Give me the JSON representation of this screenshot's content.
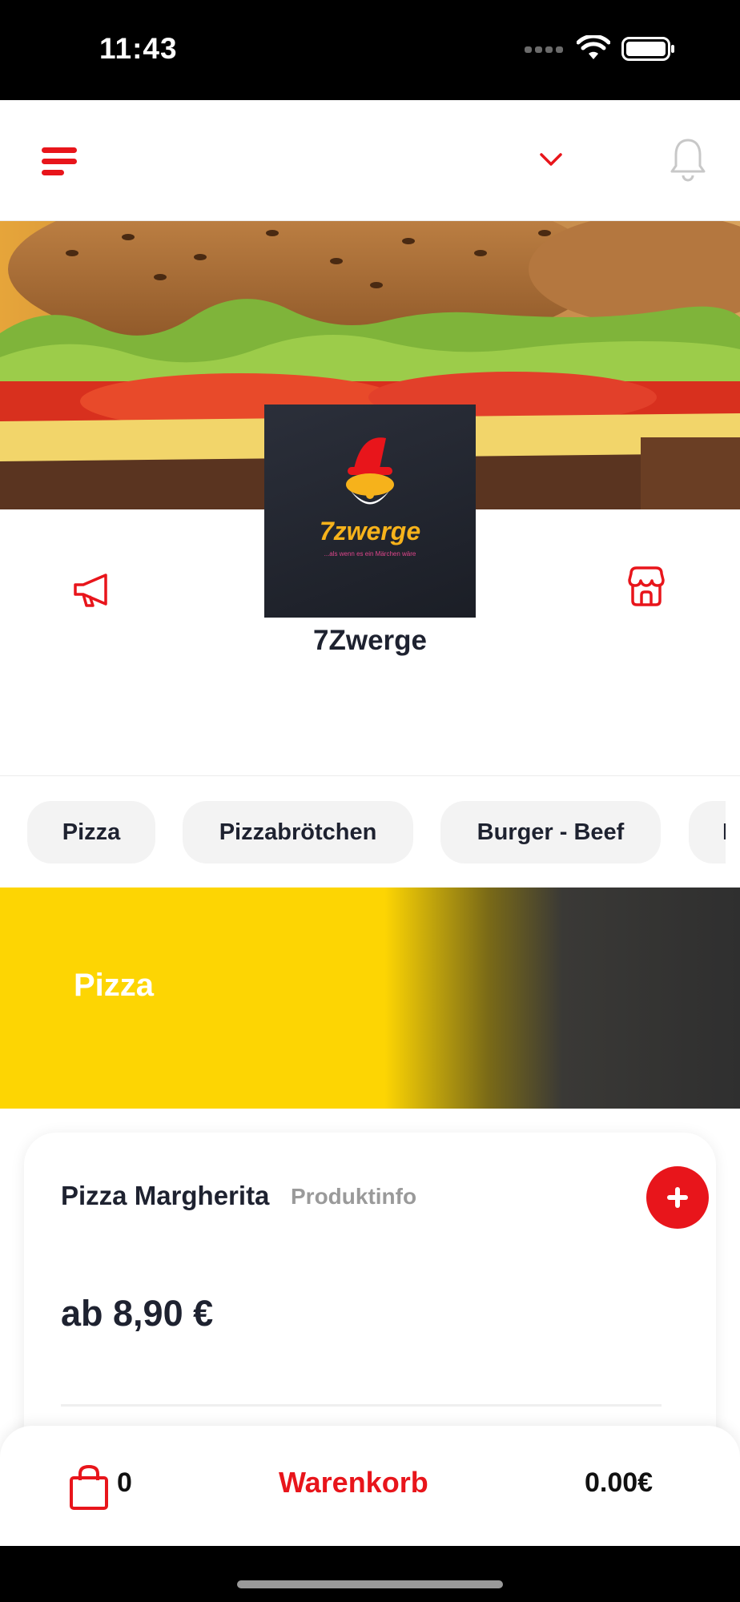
{
  "status_bar": {
    "time": "11:43"
  },
  "header": {
    "menu_icon": "menu-icon",
    "dropdown_icon": "chevron-down-icon",
    "notification_icon": "bell-icon"
  },
  "restaurant": {
    "name": "7Zwerge",
    "logo_text": "7zwerge",
    "logo_tagline": "...als wenn es ein Märchen wäre",
    "left_icon": "megaphone-icon",
    "right_icon": "shop-icon"
  },
  "categories": [
    "Pizza",
    "Pizzabrötchen",
    "Burger - Beef",
    "I"
  ],
  "banner": {
    "title": "Pizza"
  },
  "product": {
    "name": "Pizza Margherita",
    "info_link": "Produktinfo",
    "price": "ab 8,90 €"
  },
  "cart": {
    "count": "0",
    "label": "Warenkorb",
    "total": "0.00€"
  },
  "colors": {
    "accent": "#e8151b",
    "banner_yellow": "#fdd503",
    "text_dark": "#1e2230"
  }
}
